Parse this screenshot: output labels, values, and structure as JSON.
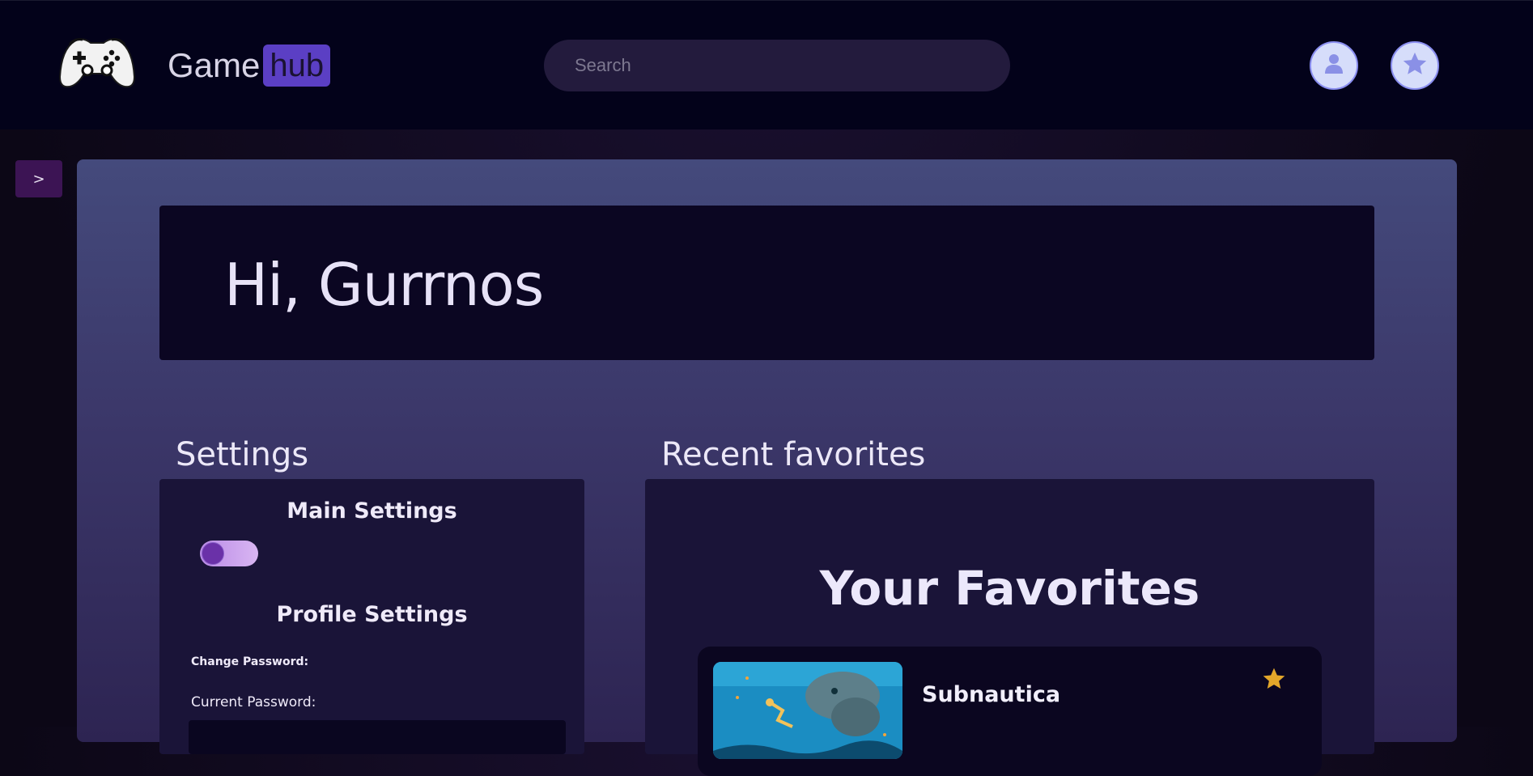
{
  "header": {
    "brand_primary": "Game",
    "brand_secondary": "hub",
    "search_placeholder": "Search",
    "logo_icon": "gamepad-icon",
    "user_icon": "user-icon",
    "favorites_icon": "star-icon"
  },
  "sidebar": {
    "toggle_label": ">"
  },
  "greeting": "Hi, Gurrnos",
  "settings": {
    "section_title": "Settings",
    "main_settings": "Main Settings",
    "profile_settings": "Profile Settings",
    "change_password": "Change Password:",
    "current_password": "Current Password:"
  },
  "favorites": {
    "section_title": "Recent favorites",
    "heading": "Your Favorites",
    "items": [
      {
        "name": "Subnautica",
        "starred": true
      }
    ]
  },
  "colors": {
    "accent": "#5b3fc4",
    "star": "#e3a62a",
    "topbar": "#03021a",
    "panel": "#444a7c"
  }
}
